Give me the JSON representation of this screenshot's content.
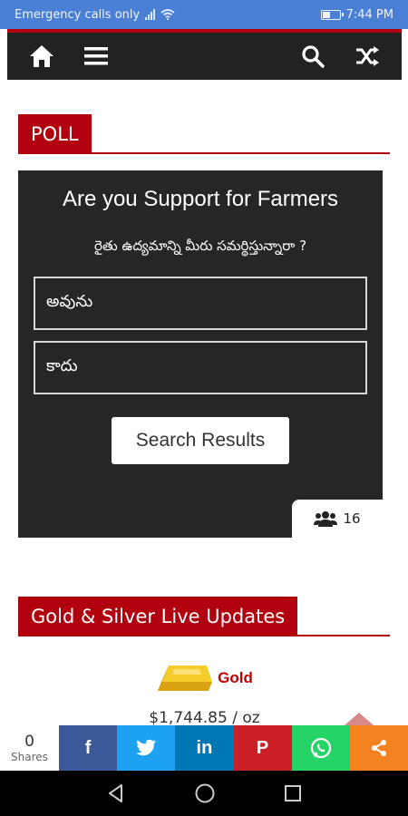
{
  "status": {
    "carrier": "Emergency calls only",
    "time": "7:44 PM"
  },
  "nav": {
    "icons": [
      "home-icon",
      "menu-icon",
      "search-icon",
      "shuffle-icon"
    ]
  },
  "poll": {
    "heading": "POLL",
    "question": "Are you Support for Farmers",
    "subtitle": "రైతు ఉద్యమాన్ని మీరు సమర్థిస్తున్నారా ?",
    "options": [
      {
        "label": "అవును"
      },
      {
        "label": "కాదు"
      }
    ],
    "results_button": "Search Results",
    "votes": "16"
  },
  "gold": {
    "heading": "Gold & Silver Live Updates",
    "label": "Gold",
    "price": "$1,744.85 / oz"
  },
  "share": {
    "count": "0",
    "count_label": "Shares",
    "buttons": [
      {
        "name": "facebook",
        "glyph": "f",
        "color": "#3b5998"
      },
      {
        "name": "twitter",
        "glyph": "t",
        "color": "#1da1f2"
      },
      {
        "name": "linkedin",
        "glyph": "in",
        "color": "#0077b5"
      },
      {
        "name": "pinterest",
        "glyph": "P",
        "color": "#cb2027"
      },
      {
        "name": "whatsapp",
        "glyph": "w",
        "color": "#25d366"
      },
      {
        "name": "share",
        "glyph": "<",
        "color": "#f58220"
      }
    ]
  },
  "colors": {
    "accent": "#b1000e",
    "status_bar": "#4a7fd6",
    "nav_bg": "#222222",
    "poll_bg": "#262626"
  }
}
